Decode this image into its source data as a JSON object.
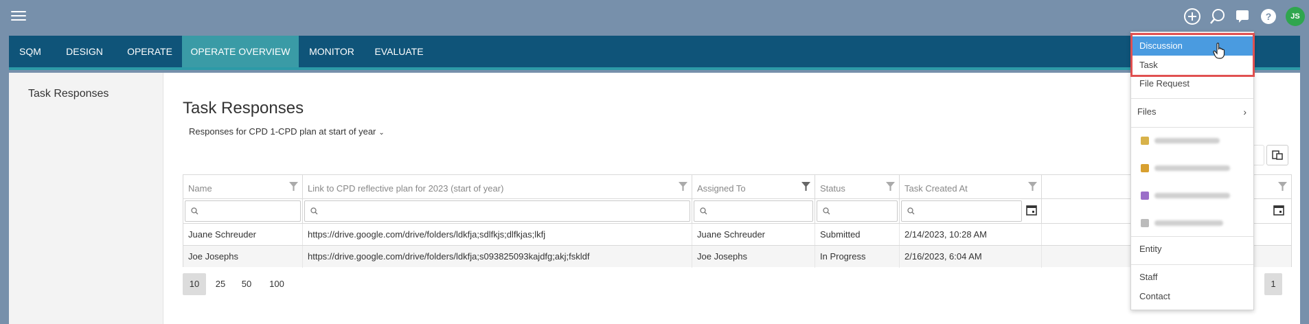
{
  "topbar": {
    "menu_icon": "hamburger-icon",
    "icons": [
      "plus-circle-icon",
      "search-icon",
      "chat-icon",
      "help-icon"
    ],
    "avatar_initials": "JS",
    "avatar_color": "#2fa64e"
  },
  "nav": {
    "tabs": [
      {
        "label": "SQM"
      },
      {
        "label": "DESIGN"
      },
      {
        "label": "OPERATE"
      },
      {
        "label": "OPERATE OVERVIEW",
        "active": true
      },
      {
        "label": "MONITOR"
      },
      {
        "label": "EVALUATE"
      }
    ],
    "bg_color": "#0f5479",
    "active_color": "#3a9ba6"
  },
  "sidebar": {
    "title": "Task Responses"
  },
  "main": {
    "title": "Task Responses",
    "subtitle": "Responses for CPD 1-CPD plan at start of year"
  },
  "grid": {
    "columns": [
      {
        "label": "Name"
      },
      {
        "label": "Link to CPD reflective plan for 2023 (start of year)"
      },
      {
        "label": "Assigned To"
      },
      {
        "label": "Status"
      },
      {
        "label": "Task Created At"
      },
      {
        "label": ""
      }
    ],
    "rows": [
      [
        "Juane Schreuder",
        "https://drive.google.com/drive/folders/ldkfja;sdlfkjs;dlfkjas;lkfj",
        "Juane Schreuder",
        "Submitted",
        "2/14/2023, 10:28 AM"
      ],
      [
        "Joe Josephs",
        "https://drive.google.com/drive/folders/ldkfja;s093825093kajdfg;akj;fskldf",
        "Joe Josephs",
        "In Progress",
        "2/16/2023, 6:04 AM"
      ]
    ]
  },
  "pager": {
    "sizes": [
      "10",
      "25",
      "50",
      "100"
    ],
    "selected_size": "10",
    "current_page": "1"
  },
  "dropdown": {
    "items": {
      "discussion": "Discussion",
      "task": "Task",
      "file_request": "File Request",
      "files": "Files",
      "entity": "Entity",
      "staff": "Staff",
      "contact": "Contact"
    },
    "highlight_color": "#4a9be0"
  }
}
